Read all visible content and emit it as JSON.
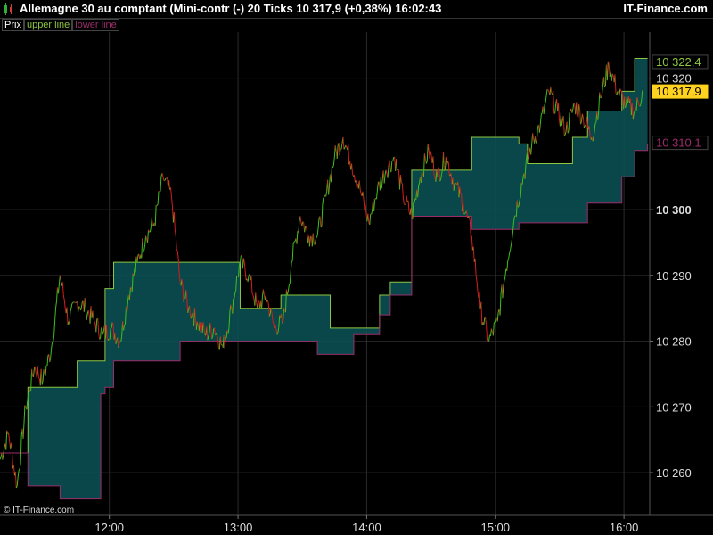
{
  "header": {
    "title": "Allemagne 30 au comptant (Mini-contr (-)   20 Ticks   10 317,9 (+0,38%)   16:02:43",
    "brand": "IT-Finance.com"
  },
  "legend": {
    "items": [
      {
        "label": "Prix",
        "color": "#ffffff"
      },
      {
        "label": "upper line",
        "color": "#8dc63f"
      },
      {
        "label": "lower line",
        "color": "#9b2d6b"
      }
    ]
  },
  "copyright": "© IT-Finance.com",
  "colors": {
    "background": "#000000",
    "grid": "#2a2a2a",
    "channel_fill": "#0b4f52",
    "upper_line": "#8dc63f",
    "lower_line": "#9b2d6b",
    "up_tick": "#3fbf1f",
    "down_tick": "#d61d1d",
    "last_price_bg": "#ffd21f"
  },
  "chart_data": {
    "type": "line",
    "title": "Allemagne 30 au comptant (Mini-contr (-)",
    "xlim": [
      "11:09",
      "16:12"
    ],
    "ylim": [
      10253.5,
      10327
    ],
    "x_ticks": [
      "12:00",
      "13:00",
      "14:00",
      "15:00",
      "16:00"
    ],
    "y_ticks": [
      {
        "value": 10260,
        "label": "10 260",
        "bold": false
      },
      {
        "value": 10270,
        "label": "10 270",
        "bold": false
      },
      {
        "value": 10280,
        "label": "10 280",
        "bold": false
      },
      {
        "value": 10290,
        "label": "10 290",
        "bold": false
      },
      {
        "value": 10300,
        "label": "10 300",
        "bold": true
      },
      {
        "value": 10320,
        "label": "10 320",
        "bold": false
      }
    ],
    "price_badges": [
      {
        "value": 10322.4,
        "label": "10 322,4",
        "kind": "upper"
      },
      {
        "value": 10317.9,
        "label": "10 317,9",
        "kind": "last"
      },
      {
        "value": 10310.1,
        "label": "10 310,1",
        "kind": "lower"
      }
    ],
    "series": [
      {
        "name": "Prix",
        "x": [
          "11:09",
          "11:13",
          "11:17",
          "11:21",
          "11:25",
          "11:29",
          "11:33",
          "11:37",
          "11:41",
          "11:45",
          "11:49",
          "11:53",
          "11:57",
          "12:01",
          "12:05",
          "12:09",
          "12:13",
          "12:17",
          "12:21",
          "12:25",
          "12:29",
          "12:33",
          "12:37",
          "12:41",
          "12:45",
          "12:49",
          "12:53",
          "12:57",
          "13:01",
          "13:05",
          "13:09",
          "13:13",
          "13:17",
          "13:21",
          "13:25",
          "13:29",
          "13:33",
          "13:37",
          "13:41",
          "13:45",
          "13:49",
          "13:53",
          "13:57",
          "14:01",
          "14:05",
          "14:09",
          "14:13",
          "14:17",
          "14:21",
          "14:25",
          "14:29",
          "14:33",
          "14:37",
          "14:41",
          "14:45",
          "14:49",
          "14:53",
          "14:57",
          "15:01",
          "15:05",
          "15:09",
          "15:13",
          "15:17",
          "15:21",
          "15:25",
          "15:29",
          "15:33",
          "15:37",
          "15:41",
          "15:45",
          "15:49",
          "15:53",
          "15:57",
          "16:01",
          "16:05",
          "16:09"
        ],
        "values": [
          10262,
          10266,
          10258,
          10270,
          10276,
          10274,
          10279,
          10290,
          10283,
          10286,
          10285,
          10283,
          10281,
          10282,
          10280,
          10287,
          10292,
          10296,
          10298,
          10305,
          10302,
          10289,
          10285,
          10283,
          10281,
          10282,
          10279,
          10285,
          10292,
          10290,
          10285,
          10287,
          10282,
          10283,
          10292,
          10299,
          10296,
          10296,
          10302,
          10308,
          10311,
          10307,
          10303,
          10298,
          10303,
          10306,
          10308,
          10302,
          10299,
          10305,
          10309,
          10305,
          10308,
          10304,
          10301,
          10296,
          10285,
          10280,
          10283,
          10291,
          10299,
          10305,
          10310,
          10313,
          10318,
          10315,
          10312,
          10316,
          10314,
          10311,
          10317,
          10322,
          10318,
          10316,
          10315,
          10318
        ]
      },
      {
        "name": "upper line",
        "x": [
          "11:09",
          "11:12",
          "11:22",
          "11:37",
          "11:45",
          "11:56",
          "11:58",
          "12:02",
          "12:12",
          "12:18",
          "12:33",
          "13:01",
          "13:20",
          "13:37",
          "13:43",
          "13:54",
          "13:58",
          "14:06",
          "14:11",
          "14:21",
          "14:31",
          "14:49",
          "15:11",
          "15:15",
          "15:30",
          "15:36",
          "15:43",
          "15:59",
          "16:05",
          "16:11"
        ],
        "values": [
          10263,
          10263,
          10273,
          10273,
          10277,
          10277,
          10288,
          10292,
          10292,
          10292,
          10292,
          10285,
          10287,
          10287,
          10282,
          10282,
          10282,
          10287,
          10289,
          10306,
          10306,
          10311,
          10310,
          10307,
          10307,
          10311,
          10315,
          10318,
          10323,
          10323
        ]
      },
      {
        "name": "lower line",
        "x": [
          "11:09",
          "11:12",
          "11:22",
          "11:37",
          "11:45",
          "11:56",
          "11:58",
          "12:02",
          "12:12",
          "12:18",
          "12:33",
          "13:01",
          "13:20",
          "13:37",
          "13:43",
          "13:54",
          "13:58",
          "14:06",
          "14:11",
          "14:21",
          "14:31",
          "14:49",
          "15:11",
          "15:15",
          "15:30",
          "15:36",
          "15:43",
          "15:59",
          "16:05",
          "16:11"
        ],
        "values": [
          10263,
          10263,
          10258,
          10256,
          10256,
          10272,
          10273,
          10277,
          10277,
          10277,
          10280,
          10280,
          10280,
          10278,
          10278,
          10281,
          10281,
          10284,
          10287,
          10299,
          10299,
          10297,
          10298,
          10298,
          10298,
          10298,
          10301,
          10305,
          10309,
          10310
        ]
      }
    ]
  }
}
